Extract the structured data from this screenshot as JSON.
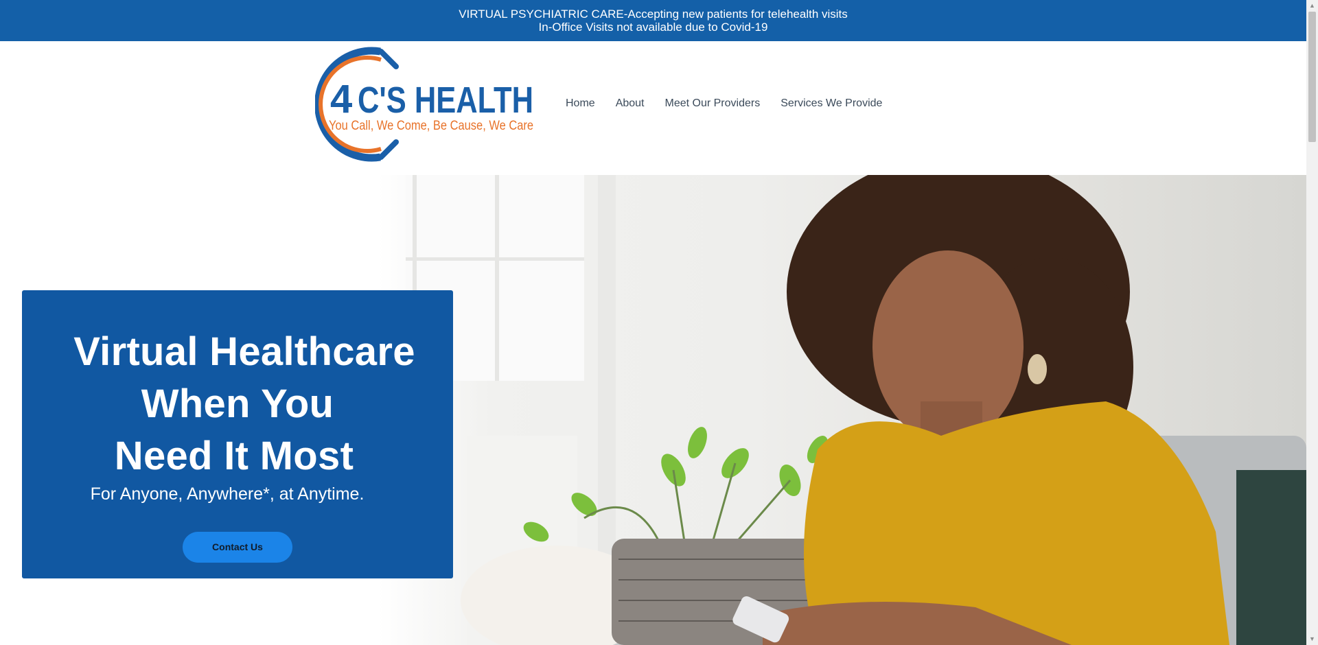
{
  "banner": {
    "line1": "VIRTUAL PSYCHIATRIC CARE-Accepting new patients for telehealth visits",
    "line2": "In-Office Visits not available due to Covid-19"
  },
  "logo": {
    "numeral": "4",
    "name": "C'S HEALTH",
    "tagline": "You Call, We Come, Be Cause, We Care",
    "colors": {
      "blue": "#1a5fa8",
      "orange": "#e8732a"
    }
  },
  "nav": {
    "items": [
      {
        "label": "Home"
      },
      {
        "label": "About"
      },
      {
        "label": "Meet Our Providers"
      },
      {
        "label": "Services We Provide"
      }
    ]
  },
  "hero": {
    "title_line1": "Virtual Healthcare",
    "title_line2": "When You",
    "title_line3": "Need It Most",
    "subtitle": "For Anyone, Anywhere*, at Anytime.",
    "cta_label": "Contact Us"
  },
  "colors": {
    "banner": "#1460a8",
    "card": "#1158a2",
    "button": "#1b84e8",
    "shirt": "#d4a017"
  }
}
